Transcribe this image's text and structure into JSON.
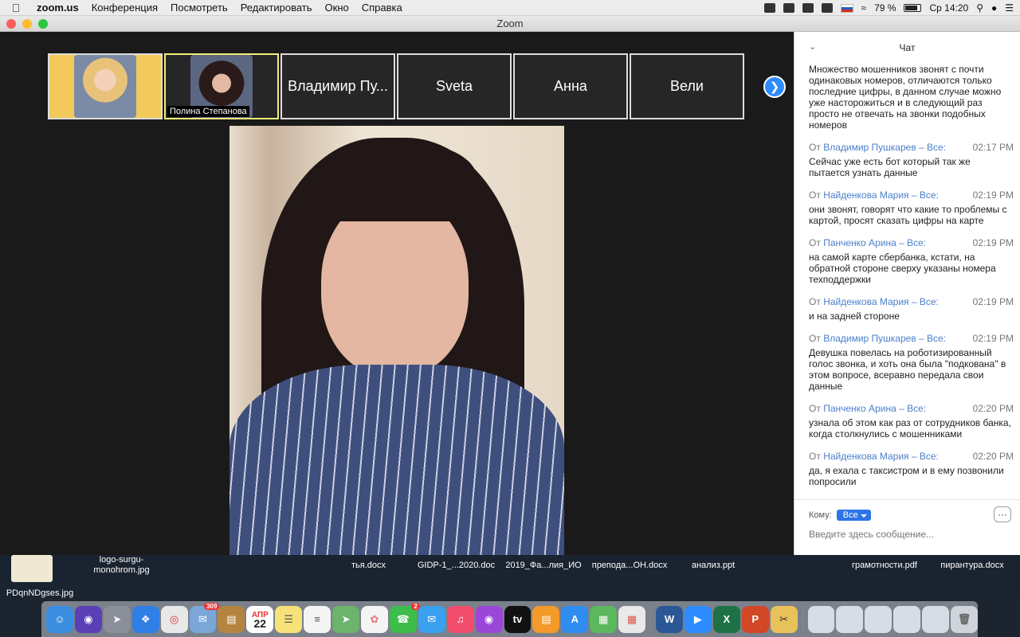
{
  "menubar": {
    "app": "zoom.us",
    "items": [
      "Конференция",
      "Посмотреть",
      "Редактировать",
      "Окно",
      "Справка"
    ],
    "battery": "79 %",
    "clock": "Ср 14:20"
  },
  "window": {
    "title": "Zoom"
  },
  "participants": [
    {
      "name": ""
    },
    {
      "name": "Полина Степанова"
    },
    {
      "name": "Владимир Пу..."
    },
    {
      "name": "Sveta"
    },
    {
      "name": "Анна"
    },
    {
      "name": "Вели"
    }
  ],
  "chat": {
    "title": "Чат",
    "first_text": "Множество мошенников звонят с почти одинаковых номеров, отличаются только последние цифры, в данном случае можно уже насторожиться и в следующий раз просто не отвечать на звонки подобных номеров",
    "messages": [
      {
        "prefix": "От",
        "sender": "Владимир Пушкарев – Все:",
        "time": "02:17 PM",
        "text": "Сейчас уже есть бот который так же пытается узнать данные"
      },
      {
        "prefix": "От",
        "sender": "Найденкова Мария – Все:",
        "time": "02:19 PM",
        "text": "они звонят, говорят что какие то проблемы с картой, просят сказать цифры на карте"
      },
      {
        "prefix": "От",
        "sender": "Панченко Арина – Все:",
        "time": "02:19 PM",
        "text": "на самой карте сбербанка, кстати, на обратной стороне сверху указаны номера техподдержки"
      },
      {
        "prefix": "От",
        "sender": "Найденкова Мария – Все:",
        "time": "02:19 PM",
        "text": "и на задней стороне"
      },
      {
        "prefix": "От",
        "sender": "Владимир Пушкарев – Все:",
        "time": "02:19 PM",
        "text": "Девушка повелась на роботизированный голос звонка, и хоть она была \"подкована\" в этом вопросе, всеравно передала свои данные"
      },
      {
        "prefix": "От",
        "sender": "Панченко Арина – Все:",
        "time": "02:20 PM",
        "text": "узнала об этом как раз от сотрудников банка, когда столкнулись с мошенниками"
      },
      {
        "prefix": "От",
        "sender": "Найденкова Мария – Все:",
        "time": "02:20 PM",
        "text": "да, я ехала с таксистром и в ему позвонили попросили"
      }
    ],
    "to_label": "Кому:",
    "to_value": "Все",
    "more": "···",
    "input_placeholder": "Введите здесь сообщение..."
  },
  "desktop": {
    "files": [
      {
        "name": "logo-surgu-\nmonohrom.jpg"
      },
      {
        "name": "PDqnNDgses.jpg"
      },
      {
        "name": "тья.docx"
      },
      {
        "name": "GIDP-1_...2020.doc"
      },
      {
        "name": "2019_Фа...лия_ИО"
      },
      {
        "name": "препода...ОН.docx"
      },
      {
        "name": "анализ.ppt"
      },
      {
        "name": "грамотности.pdf"
      },
      {
        "name": "пирантура.docx"
      }
    ]
  },
  "dock": {
    "badges": {
      "mail": "309",
      "calendar_day": "22",
      "calendar_month": "АПР",
      "facetime": "2"
    }
  },
  "colors": {
    "accent": "#2d8cff",
    "sender": "#4a7fcb",
    "select": "#2d74e8"
  }
}
